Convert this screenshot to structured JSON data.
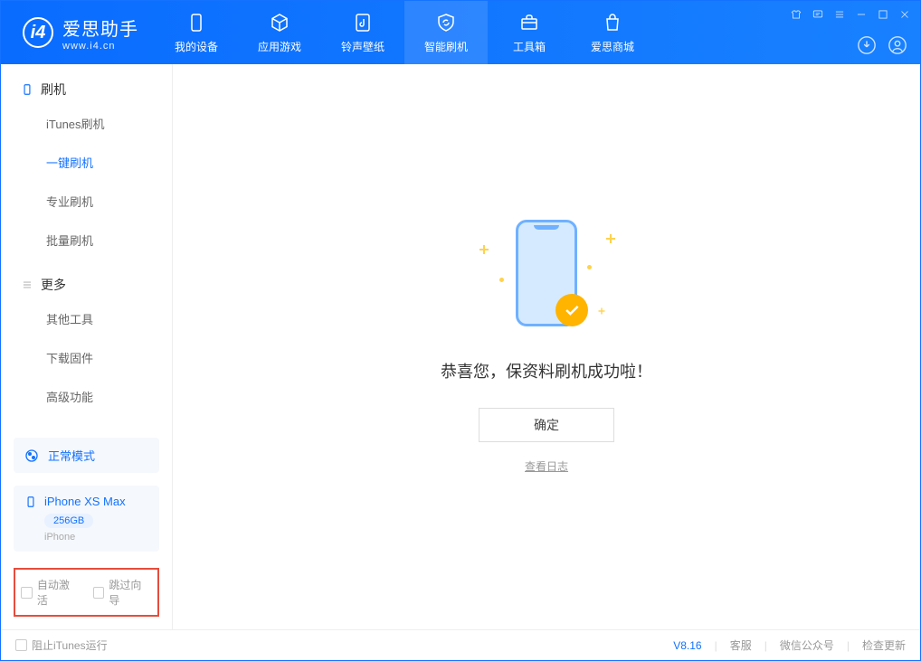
{
  "app": {
    "name": "爱思助手",
    "site": "www.i4.cn"
  },
  "tabs": [
    {
      "label": "我的设备"
    },
    {
      "label": "应用游戏"
    },
    {
      "label": "铃声壁纸"
    },
    {
      "label": "智能刷机"
    },
    {
      "label": "工具箱"
    },
    {
      "label": "爱思商城"
    }
  ],
  "sidebar": {
    "group1": {
      "label": "刷机"
    },
    "items1": [
      {
        "label": "iTunes刷机"
      },
      {
        "label": "一键刷机"
      },
      {
        "label": "专业刷机"
      },
      {
        "label": "批量刷机"
      }
    ],
    "group2": {
      "label": "更多"
    },
    "items2": [
      {
        "label": "其他工具"
      },
      {
        "label": "下载固件"
      },
      {
        "label": "高级功能"
      }
    ]
  },
  "device": {
    "mode": "正常模式",
    "name": "iPhone XS Max",
    "storage": "256GB",
    "type": "iPhone"
  },
  "options": {
    "auto_activate": "自动激活",
    "skip_guide": "跳过向导"
  },
  "main": {
    "message": "恭喜您，保资料刷机成功啦！",
    "ok": "确定",
    "view_log": "查看日志"
  },
  "footer": {
    "block_itunes": "阻止iTunes运行",
    "version": "V8.16",
    "support": "客服",
    "wechat": "微信公众号",
    "check_update": "检查更新"
  }
}
